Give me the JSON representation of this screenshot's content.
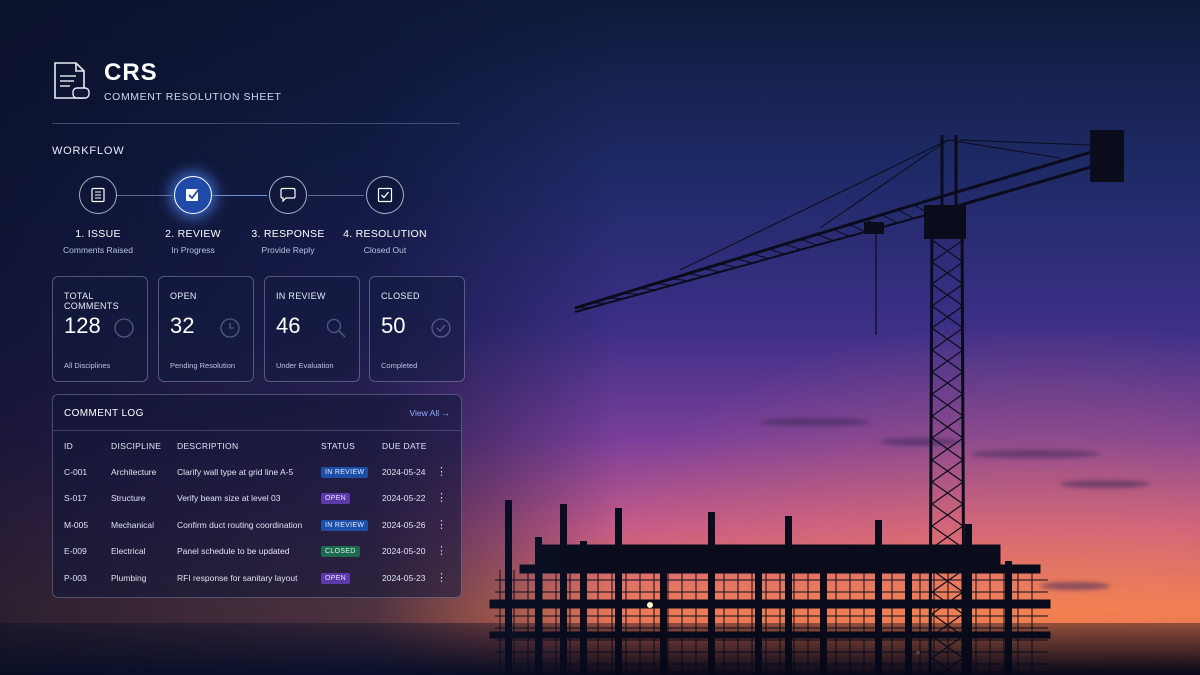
{
  "brand": {
    "title": "CRS",
    "subtitle": "COMMENT RESOLUTION SHEET",
    "icon": "document-comment-icon"
  },
  "workflow": {
    "title": "WORKFLOW",
    "steps": [
      {
        "label": "1. ISSUE",
        "sub": "Comments Raised",
        "icon": "list-icon",
        "active": false
      },
      {
        "label": "2. REVIEW",
        "sub": "In Progress",
        "icon": "edit-check-icon",
        "active": true
      },
      {
        "label": "3. RESPONSE",
        "sub": "Provide Reply",
        "icon": "chat-icon",
        "active": false
      },
      {
        "label": "4. RESOLUTION",
        "sub": "Closed Out",
        "icon": "checkbox-icon",
        "active": false
      }
    ]
  },
  "stats": [
    {
      "label": "TOTAL COMMENTS",
      "value": "128",
      "sub": "All Disciplines",
      "icon": "circle-icon"
    },
    {
      "label": "OPEN",
      "value": "32",
      "sub": "Pending Resolution",
      "icon": "clock-icon"
    },
    {
      "label": "IN REVIEW",
      "value": "46",
      "sub": "Under Evaluation",
      "icon": "magnifier-icon"
    },
    {
      "label": "CLOSED",
      "value": "50",
      "sub": "Completed",
      "icon": "check-circle-icon"
    }
  ],
  "log": {
    "title": "COMMENT LOG",
    "view_all": "View All →",
    "columns": [
      "ID",
      "DISCIPLINE",
      "DESCRIPTION",
      "STATUS",
      "DUE DATE"
    ],
    "rows": [
      {
        "id": "C-001",
        "discipline": "Architecture",
        "description": "Clarify wall type at grid line A-5",
        "status": "IN REVIEW",
        "due": "2024-05-24"
      },
      {
        "id": "S-017",
        "discipline": "Structure",
        "description": "Verify beam size at level 03",
        "status": "OPEN",
        "due": "2024-05-22"
      },
      {
        "id": "M-005",
        "discipline": "Mechanical",
        "description": "Confirm duct routing coordination",
        "status": "IN REVIEW",
        "due": "2024-05-26"
      },
      {
        "id": "E-009",
        "discipline": "Electrical",
        "description": "Panel schedule to be updated",
        "status": "CLOSED",
        "due": "2024-05-20"
      },
      {
        "id": "P-003",
        "discipline": "Plumbing",
        "description": "RFI response for sanitary layout",
        "status": "OPEN",
        "due": "2024-05-23"
      }
    ]
  },
  "colors": {
    "accent": "#1f4aa8",
    "in_review": "#1d4fa8",
    "open": "#5a3aa8",
    "closed": "#1d6b4e"
  }
}
